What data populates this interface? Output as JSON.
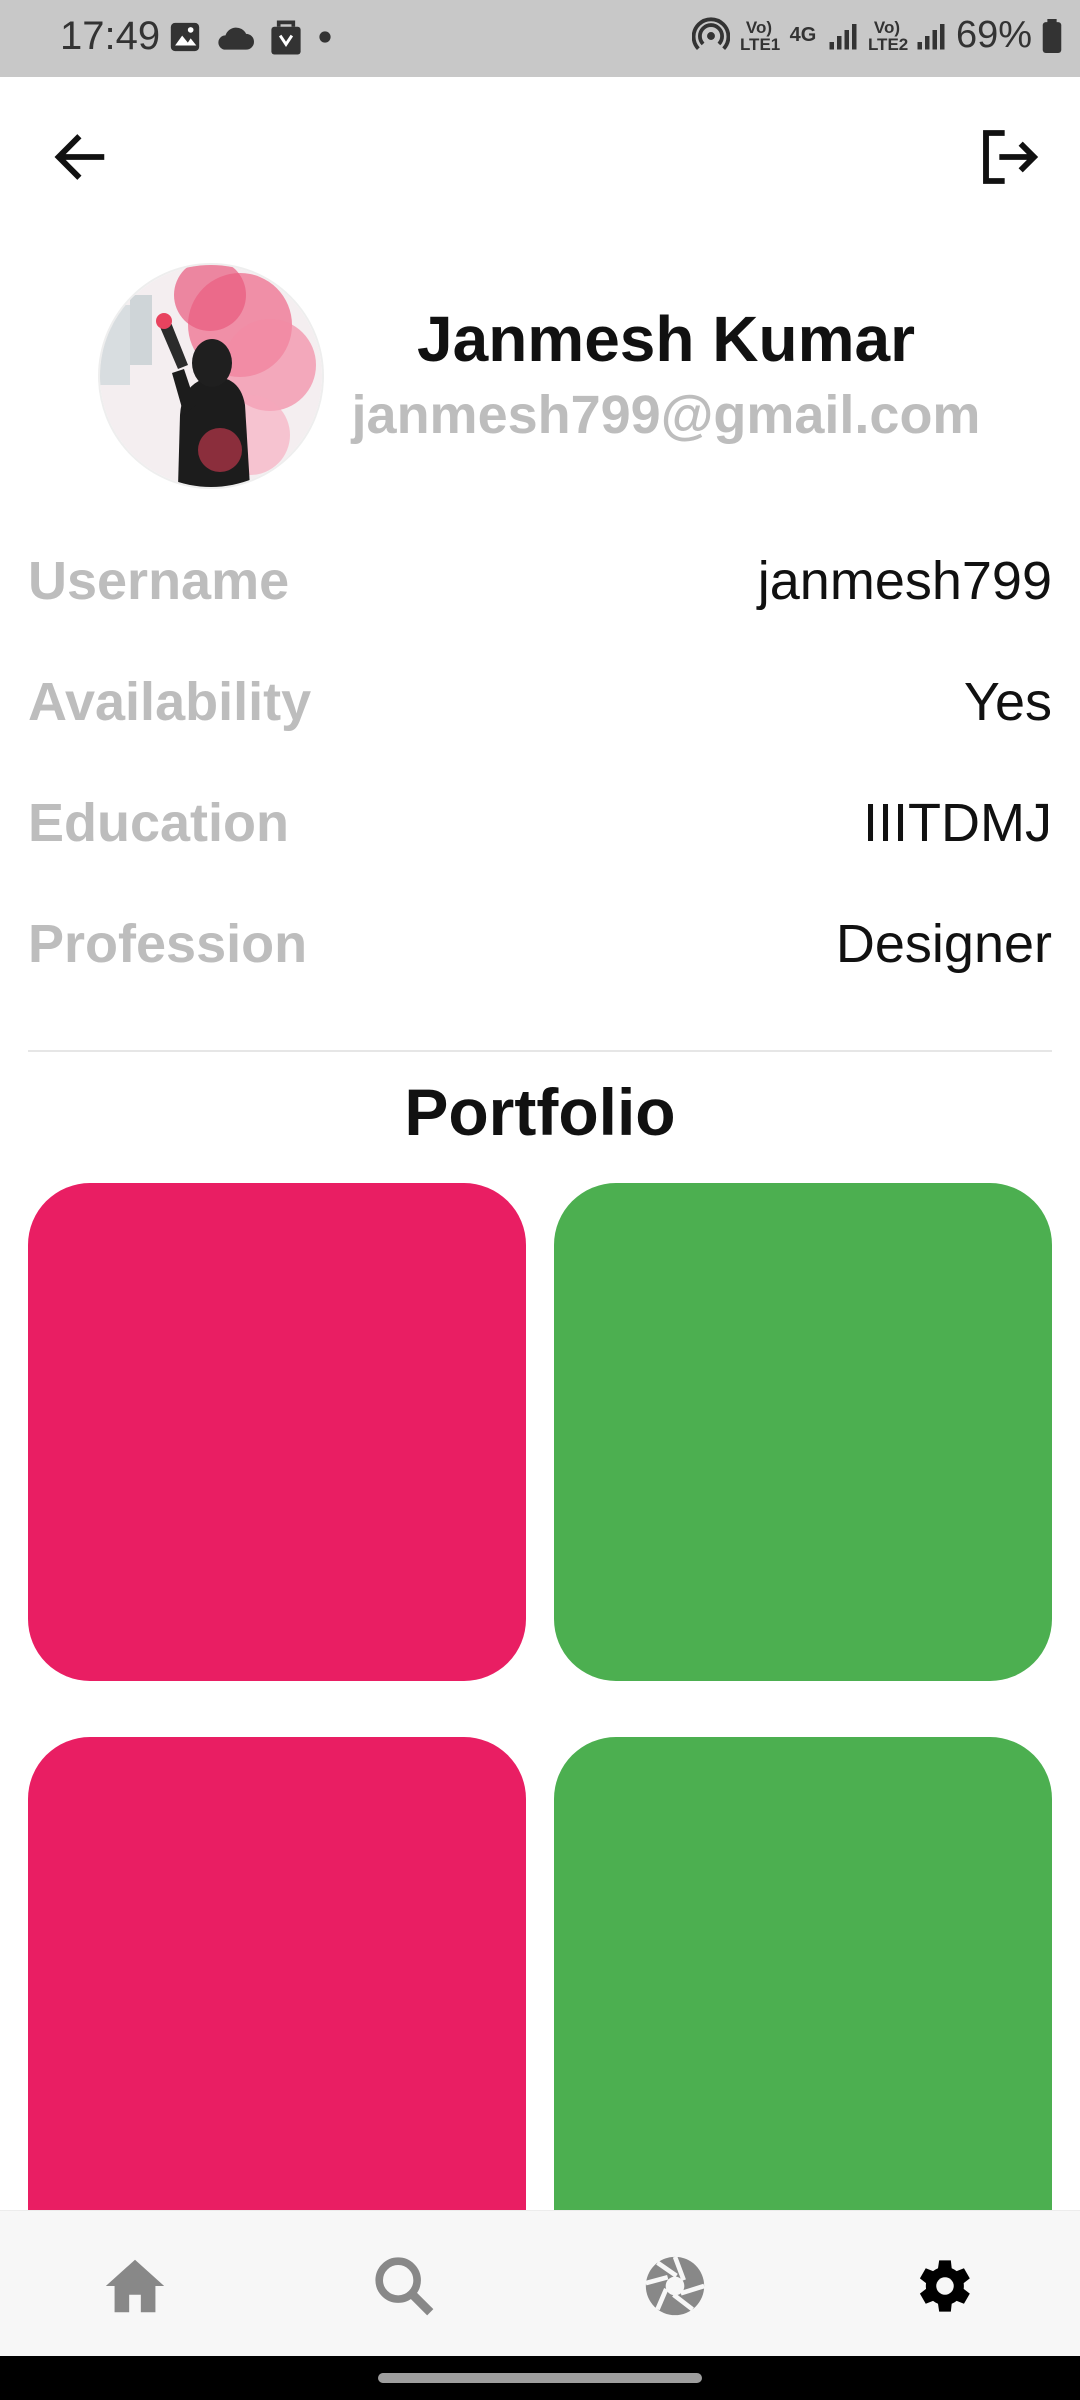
{
  "status_bar": {
    "time": "17:49",
    "battery": "69%",
    "left_icons": [
      "gallery-icon",
      "cloud-icon",
      "bag-icon",
      "dot-icon"
    ],
    "right_icons": [
      "hotspot-icon",
      "volte-lte1-icon",
      "4g-icon",
      "signal-icon",
      "volte-lte2-icon",
      "signal-icon",
      "battery-icon"
    ],
    "sim1_label": "Vo) LTE1",
    "data_label": "4G",
    "sim2_label": "Vo) LTE2"
  },
  "header": {
    "back_icon": "arrow-left-icon",
    "logout_icon": "logout-icon"
  },
  "profile": {
    "name": "Janmesh Kumar",
    "email": "janmesh799@gmail.com",
    "avatar": "avatar-photo"
  },
  "details": [
    {
      "label": "Username",
      "value": "janmesh799"
    },
    {
      "label": "Availability",
      "value": "Yes"
    },
    {
      "label": "Education",
      "value": "IIITDMJ"
    },
    {
      "label": "Profession",
      "value": "Designer"
    }
  ],
  "portfolio": {
    "title": "Portfolio",
    "tiles": [
      {
        "color": "#e91e63"
      },
      {
        "color": "#4caf50"
      },
      {
        "color": "#e91e63"
      },
      {
        "color": "#4caf50"
      }
    ]
  },
  "bottom_nav": [
    {
      "icon": "home-icon",
      "active": false
    },
    {
      "icon": "search-icon",
      "active": false
    },
    {
      "icon": "camera-aperture-icon",
      "active": false
    },
    {
      "icon": "settings-icon",
      "active": true
    }
  ],
  "colors": {
    "label_gray": "#bdbdbd",
    "inactive_nav": "#888888",
    "active_nav": "#000000"
  }
}
